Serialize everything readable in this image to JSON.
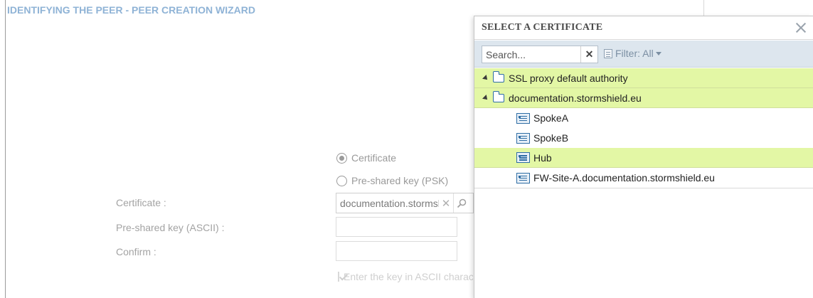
{
  "wizard": {
    "title": "IDENTIFYING THE PEER - PEER CREATION WIZARD",
    "auth_methods": [
      {
        "label": "Certificate",
        "checked": true
      },
      {
        "label": "Pre-shared key (PSK)",
        "checked": false
      }
    ],
    "certificate_label": "Certificate :",
    "certificate_value": "documentation.stormshield.eu",
    "psk_label": "Pre-shared key (ASCII) :",
    "confirm_label": "Confirm :",
    "ascii_checkbox_label": "Enter the key in ASCII characters"
  },
  "popup": {
    "title": "SELECT A CERTIFICATE",
    "search_placeholder": "Search...",
    "filter_label": "Filter: All",
    "tree": [
      {
        "label": "SSL proxy default authority",
        "type": "group",
        "highlighted": true
      },
      {
        "label": "documentation.stormshield.eu",
        "type": "group",
        "highlighted": true
      },
      {
        "label": "SpokeA",
        "type": "leaf",
        "highlighted": false
      },
      {
        "label": "SpokeB",
        "type": "leaf",
        "highlighted": false
      },
      {
        "label": "Hub",
        "type": "leaf",
        "highlighted": true
      },
      {
        "label": "FW-Site-A.documentation.stormshield.eu",
        "type": "leaf",
        "highlighted": false
      }
    ]
  }
}
